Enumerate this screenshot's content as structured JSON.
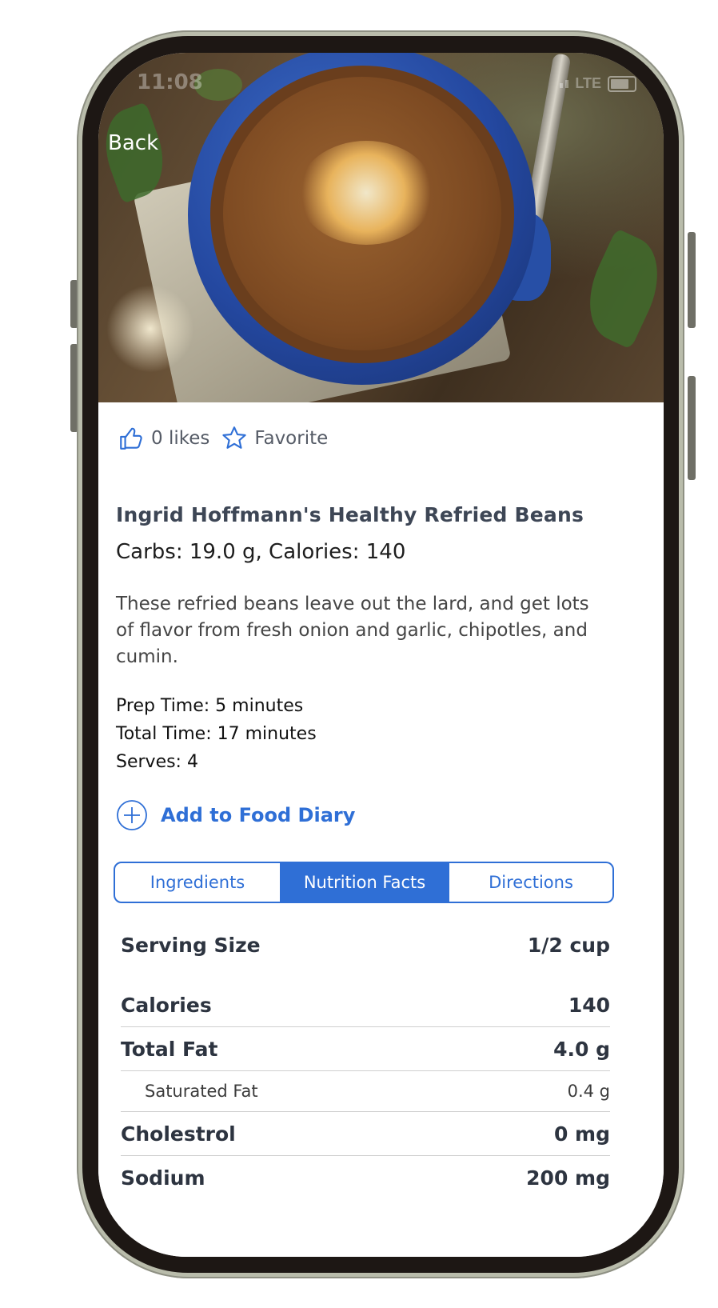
{
  "status": {
    "time": "11:08",
    "network": "LTE"
  },
  "nav": {
    "back_label": "Back"
  },
  "actions": {
    "likes_label": "0 likes",
    "favorite_label": "Favorite"
  },
  "recipe": {
    "title": "Ingrid Hoffmann's Healthy Refried Beans",
    "summary": "Carbs: 19.0 g, Calories: 140",
    "description": "These refried beans leave out the lard, and get lots of flavor from fresh onion and garlic, chipotles, and cumin.",
    "prep_time": "Prep Time: 5 minutes",
    "total_time": "Total Time: 17 minutes",
    "serves": "Serves: 4"
  },
  "diary": {
    "add_label": "Add to Food Diary"
  },
  "tabs": [
    {
      "label": "Ingredients"
    },
    {
      "label": "Nutrition Facts"
    },
    {
      "label": "Directions"
    }
  ],
  "nutrition": {
    "serving": {
      "label": "Serving Size",
      "value": "1/2 cup"
    },
    "rows": [
      {
        "label": "Calories",
        "value": "140"
      },
      {
        "label": "Total Fat",
        "value": "4.0 g"
      },
      {
        "label": "Saturated Fat",
        "value": "0.4 g"
      },
      {
        "label": "Cholestrol",
        "value": "0 mg"
      },
      {
        "label": "Sodium",
        "value": "200 mg"
      }
    ]
  },
  "colors": {
    "accent": "#2f6fd6",
    "title_text": "#3d4655"
  }
}
